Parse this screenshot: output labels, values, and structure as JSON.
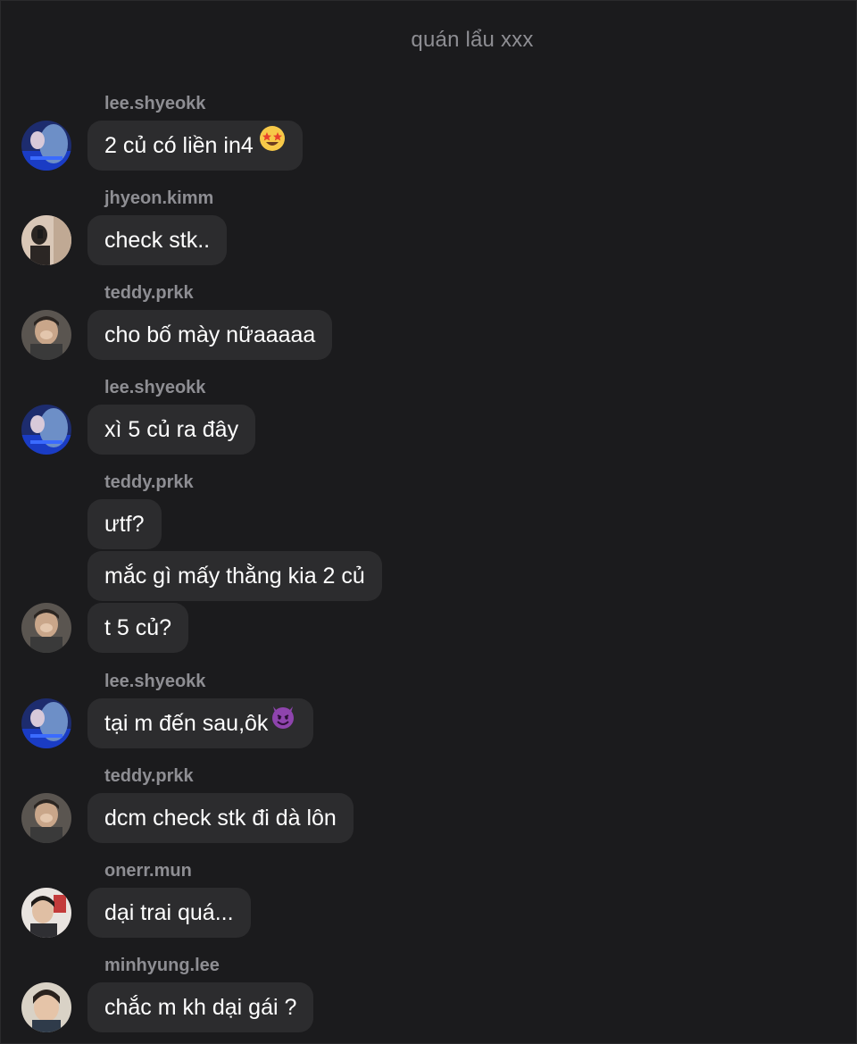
{
  "header": {
    "title": "quán lẩu xxx"
  },
  "messages": [
    {
      "username": "lee.shyeokk",
      "text": "2 củ có liền in4",
      "emoji": "star-struck-emoji"
    },
    {
      "username": "jhyeon.kimm",
      "text": "check stk.."
    },
    {
      "username": "teddy.prkk",
      "text": "cho bố mày nữaaaaa"
    },
    {
      "username": "lee.shyeokk",
      "text": "xì 5 củ ra đây"
    },
    {
      "username": "teddy.prkk",
      "text": "ưtf?"
    },
    {
      "text": "mắc gì mấy thằng kia 2 củ"
    },
    {
      "text": "t 5 củ?"
    },
    {
      "username": "lee.shyeokk",
      "text": "tại m đến sau,ôk",
      "emoji": "smiling-devil-emoji"
    },
    {
      "username": "teddy.prkk",
      "text": "dcm check stk đi dà lôn"
    },
    {
      "username": "onerr.mun",
      "text": "dại trai quá..."
    },
    {
      "username": "minhyung.lee",
      "text": "chắc m kh dại gái ?"
    }
  ],
  "colors": {
    "background": "#1b1b1d",
    "bubble": "#2c2c2e",
    "username": "#8e8e93",
    "message_text": "#ffffff"
  }
}
